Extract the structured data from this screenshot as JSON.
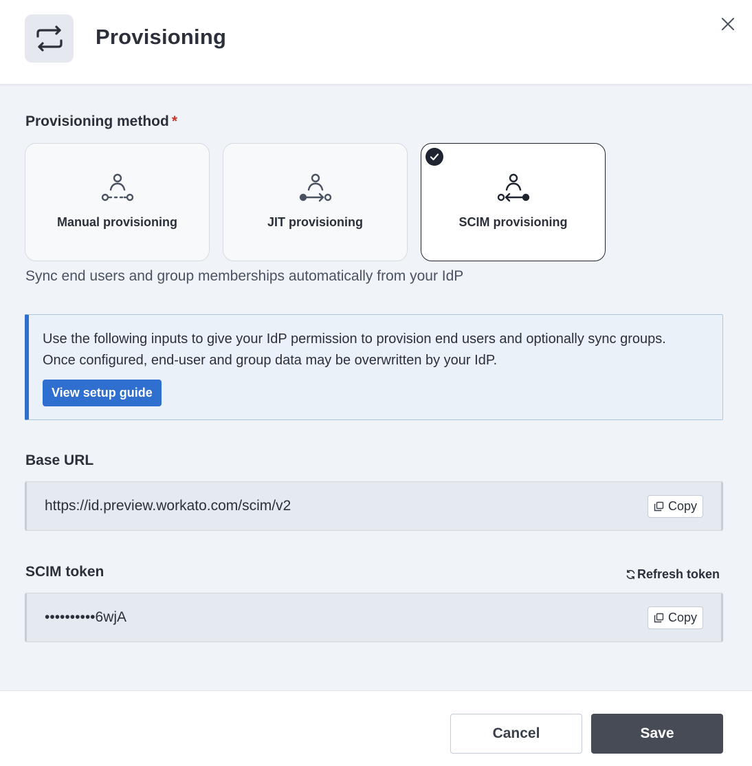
{
  "header": {
    "title": "Provisioning",
    "icon": "swap-arrows-icon",
    "close_icon": "close-icon"
  },
  "method": {
    "label": "Provisioning method",
    "required_marker": "*",
    "options": [
      {
        "label": "Manual provisioning",
        "icon": "manual-provisioning-icon",
        "selected": false
      },
      {
        "label": "JIT provisioning",
        "icon": "jit-provisioning-icon",
        "selected": false
      },
      {
        "label": "SCIM provisioning",
        "icon": "scim-provisioning-icon",
        "selected": true
      }
    ],
    "description": "Sync end users and group memberships automatically from your IdP"
  },
  "info": {
    "line1": "Use the following inputs to give your IdP permission to provision end users and optionally sync groups.",
    "line2": "Once configured, end-user and group data may be overwritten by your IdP.",
    "button_label": "View setup guide"
  },
  "base_url": {
    "label": "Base URL",
    "value": "https://id.preview.workato.com/scim/v2",
    "copy_label": "Copy"
  },
  "scim_token": {
    "label": "SCIM token",
    "refresh_label": "Refresh token",
    "value": "••••••••••6wjA",
    "copy_label": "Copy"
  },
  "footer": {
    "cancel_label": "Cancel",
    "save_label": "Save"
  },
  "colors": {
    "accent": "#2f6fcf",
    "required": "#c9372c",
    "primary_button": "#464b55"
  }
}
